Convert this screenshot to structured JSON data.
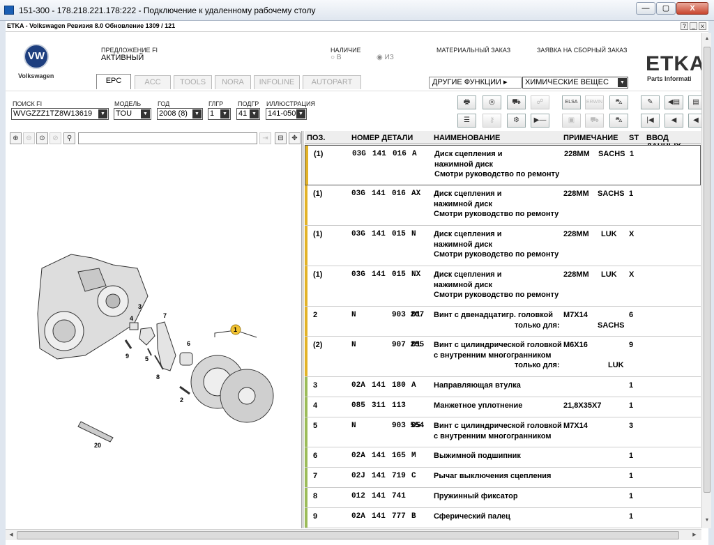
{
  "rdp": {
    "title": "151-300 - 178.218.221.178:222 - Подключение к удаленному рабочему столу",
    "min": "—",
    "max": "▢",
    "close": "X"
  },
  "app": {
    "title": "ETKA - Volkswagen Ревизия 8.0 Обновление 1309 / 121",
    "help": "?",
    "min": "_",
    "close": "x"
  },
  "brand": {
    "logo": "VW",
    "name": "Volkswagen",
    "etka": "ETKA",
    "etka_sub": "Parts Informati"
  },
  "status": {
    "fi_label": "ПРЕДЛОЖЕНИЕ FI",
    "fi_value": "АКТИВНЫЙ",
    "avail_label": "НАЛИЧИЕ",
    "avail_in": "В",
    "avail_of": "ИЗ",
    "material_order": "МАТЕРИАЛЬНЫЙ ЗАКАЗ",
    "assembly_order": "ЗАЯВКА НА СБОРНЫЙ ЗАКАЗ"
  },
  "tabs": [
    "EPC",
    "ACC",
    "TOOLS",
    "NORA",
    "INFOLINE",
    "AUTOPART"
  ],
  "other_functions": "ДРУГИЕ ФУНКЦИИ ▸",
  "chem_select": "ХИМИЧЕСКИЕ ВЕЩЕС",
  "form": {
    "fi_search_label": "ПОИСК FI",
    "fi_search_value": "WVGZZZ1TZ8W13619",
    "model_label": "МОДЕЛЬ",
    "model_value": "TOU",
    "year_label": "ГОД",
    "year_value": "2008 (8)",
    "mg_label": "ГЛГР",
    "mg_value": "1",
    "sg_label": "ПОДГР",
    "sg_value": "41",
    "illus_label": "ИЛЛЮСТРАЦИЯ",
    "illus_value": "141-050"
  },
  "toolbar_icons": {
    "row1": [
      "printer-icon",
      "cd-icon",
      "car-icon",
      "hands-icon",
      "elsa-icon",
      "erwin-icon",
      "cart-icon",
      "pin-icon",
      "prev-page-icon",
      "doc-icon"
    ],
    "row2": [
      "list-icon",
      "key-icon",
      "bike-icon",
      "play-minus-icon",
      "elsa2-icon",
      "car2-icon",
      "cart2-icon",
      "first-icon",
      "prev-icon",
      "back-icon"
    ],
    "labels": {
      "elsa": "ELSA",
      "erwin": "ERWIN"
    }
  },
  "table": {
    "headers": {
      "pos": "ПОЗ.",
      "part": "НОМЕР ДЕТАЛИ",
      "name": "НАИМЕНОВАНИЕ",
      "note": "ПРИМЕЧАНИЕ",
      "st": "ST",
      "input": "ВВОД ДАННЫХ"
    },
    "rows": [
      {
        "pos": "(1)",
        "p1": "03G",
        "p2": "141",
        "p3": "016",
        "p4": "A",
        "name": [
          "Диск сцепления и",
          "нажимной диск",
          "Смотри руководство по ремонту"
        ],
        "note1": "228MM",
        "note2": "SACHS",
        "st": "1",
        "color": "#e2b227"
      },
      {
        "pos": "(1)",
        "p1": "03G",
        "p2": "141",
        "p3": "016",
        "p4": "AX",
        "name": [
          "Диск сцепления и",
          "нажимной диск",
          "Смотри руководство по ремонту"
        ],
        "note1": "228MM",
        "note2": "SACHS",
        "st": "1",
        "color": "#e2b227"
      },
      {
        "pos": "(1)",
        "p1": "03G",
        "p2": "141",
        "p3": "015",
        "p4": "N",
        "name": [
          "Диск сцепления и",
          "нажимной диск",
          "Смотри руководство по ремонту"
        ],
        "note1": "228MM",
        "note2": "LUK",
        "st": "X",
        "color": "#e2b227"
      },
      {
        "pos": "(1)",
        "p1": "03G",
        "p2": "141",
        "p3": "015",
        "p4": "NX",
        "name": [
          "Диск сцепления и",
          "нажимной диск",
          "Смотри руководство по ремонту"
        ],
        "note1": "228MM",
        "note2": "LUK",
        "st": "X",
        "color": "#e2b227"
      },
      {
        "pos": "2",
        "p1": "N",
        "p2": "",
        "p3": "903 207",
        "p4": "01",
        "name": [
          "Винт с двенадцатигр. головкой",
          "только для:"
        ],
        "note1": "M7X14",
        "note2": "SACHS",
        "st": "6",
        "color": "#e2b227"
      },
      {
        "pos": "(2)",
        "p1": "N",
        "p2": "",
        "p3": "907 255",
        "p4": "01",
        "name": [
          "Винт с цилиндрической головкой",
          "с внутренним многогранником",
          "только для:"
        ],
        "note1": "M6X16",
        "note2": "LUK",
        "st": "9",
        "color": "#e2b227"
      },
      {
        "pos": "3",
        "p1": "02A",
        "p2": "141",
        "p3": "180",
        "p4": "A",
        "name": [
          "Направляющая втулка"
        ],
        "note1": "",
        "note2": "",
        "st": "1",
        "color": "#9bbb59"
      },
      {
        "pos": "4",
        "p1": "085",
        "p2": "311",
        "p3": "113",
        "p4": "",
        "name": [
          "Манжетное уплотнение"
        ],
        "note1": "21,8X35X7",
        "note2": "",
        "st": "1",
        "color": "#9bbb59"
      },
      {
        "pos": "5",
        "p1": "N",
        "p2": "",
        "p3": "903 554",
        "p4": "05",
        "name": [
          "Винт с цилиндрической головкой",
          "с внутренним многогранником"
        ],
        "note1": "M7X14",
        "note2": "",
        "st": "3",
        "color": "#9bbb59"
      },
      {
        "pos": "6",
        "p1": "02A",
        "p2": "141",
        "p3": "165",
        "p4": "M",
        "name": [
          "Выжимной подшипник"
        ],
        "note1": "",
        "note2": "",
        "st": "1",
        "color": "#9bbb59"
      },
      {
        "pos": "7",
        "p1": "02J",
        "p2": "141",
        "p3": "719",
        "p4": "C",
        "name": [
          "Рычаг выключения сцепления"
        ],
        "note1": "",
        "note2": "",
        "st": "1",
        "color": "#9bbb59"
      },
      {
        "pos": "8",
        "p1": "012",
        "p2": "141",
        "p3": "741",
        "p4": "",
        "name": [
          "Пружинный фиксатор"
        ],
        "note1": "",
        "note2": "",
        "st": "1",
        "color": "#9bbb59"
      },
      {
        "pos": "9",
        "p1": "02A",
        "p2": "141",
        "p3": "777",
        "p4": "B",
        "name": [
          "Сферический палец"
        ],
        "note1": "",
        "note2": "",
        "st": "1",
        "color": "#9bbb59"
      }
    ]
  },
  "diagram": {
    "callouts": [
      "1",
      "2",
      "3",
      "4",
      "5",
      "6",
      "7",
      "8",
      "9",
      "20"
    ]
  }
}
